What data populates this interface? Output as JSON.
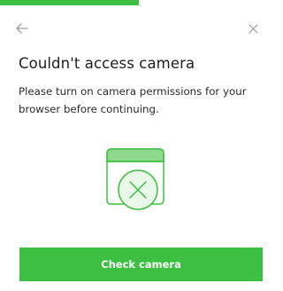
{
  "progress": {
    "fraction": 0.51,
    "color": "#3dbf41"
  },
  "header": {
    "back_icon": "arrow-left-icon",
    "close_icon": "close-icon"
  },
  "content": {
    "title": "Couldn't access camera",
    "message": "Please turn on camera permissions for your browser before continuing.",
    "illustration_icon": "browser-window-error-icon"
  },
  "actions": {
    "primary_label": "Check camera"
  },
  "colors": {
    "accent": "#3dbf41",
    "accent_light": "#8fd98c",
    "illustration_fill": "#eaf8e9",
    "icon_gray": "#9a9a9a",
    "text": "#1d1d1d"
  }
}
